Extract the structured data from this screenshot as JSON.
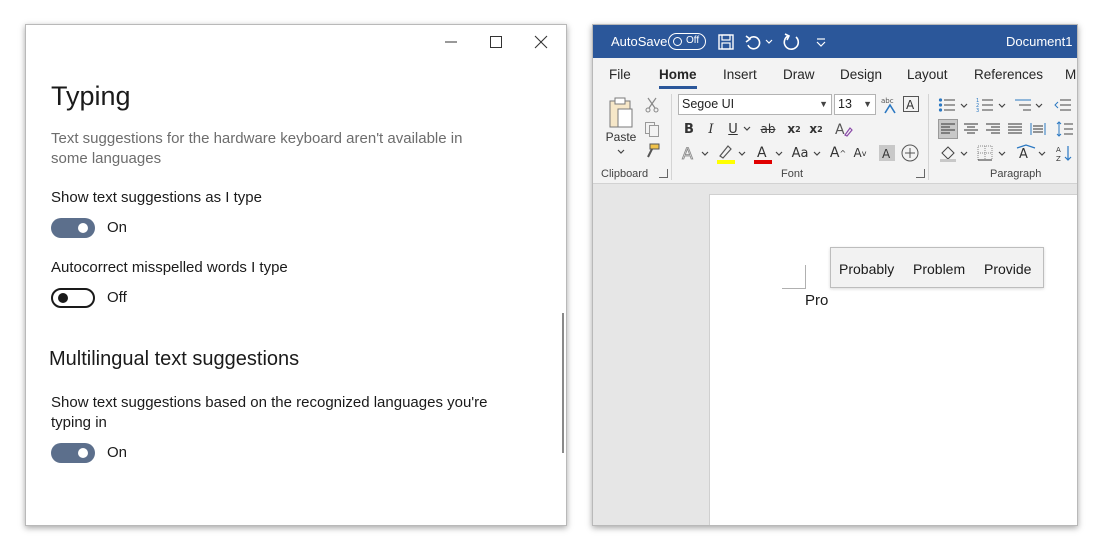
{
  "settings": {
    "title": "Typing",
    "description": "Text suggestions for the hardware keyboard aren't available in some languages",
    "show_suggestions": {
      "label": "Show text suggestions as I type",
      "state": "On",
      "enabled": true
    },
    "autocorrect": {
      "label": "Autocorrect misspelled words I type",
      "state": "Off",
      "enabled": false
    },
    "multilingual_heading": "Multilingual text suggestions",
    "multilingual": {
      "label": "Show text suggestions based on the recognized languages you're typing in",
      "state": "On",
      "enabled": true
    },
    "window_controls": [
      "minimize-icon",
      "maximize-icon",
      "close-icon"
    ]
  },
  "word": {
    "autosave_label": "AutoSave",
    "autosave_state": "Off",
    "document_name": "Document1",
    "tabs": [
      {
        "label": "File",
        "active": false
      },
      {
        "label": "Home",
        "active": true
      },
      {
        "label": "Insert",
        "active": false
      },
      {
        "label": "Draw",
        "active": false
      },
      {
        "label": "Design",
        "active": false
      },
      {
        "label": "Layout",
        "active": false
      },
      {
        "label": "References",
        "active": false
      },
      {
        "label": "M",
        "active": false
      }
    ],
    "ribbon": {
      "clipboard": {
        "paste_label": "Paste",
        "group_label": "Clipboard"
      },
      "font": {
        "font_name": "Segoe UI",
        "font_size": "13",
        "bold": "B",
        "italic": "I",
        "underline": "U",
        "strikethrough": "ab",
        "subscript": "x",
        "superscript": "x",
        "change_case": "Aa",
        "grow_font": "A",
        "shrink_font": "A",
        "highlight_color": "#ffff00",
        "font_color": "#e00000",
        "group_label": "Font"
      },
      "paragraph": {
        "group_label": "Paragraph"
      }
    },
    "document": {
      "typed_text": "Pro",
      "suggestions": [
        "Probably",
        "Problem",
        "Provide"
      ]
    },
    "colors": {
      "titlebar": "#2b579a",
      "ribbon": "#f3f3f3"
    }
  }
}
